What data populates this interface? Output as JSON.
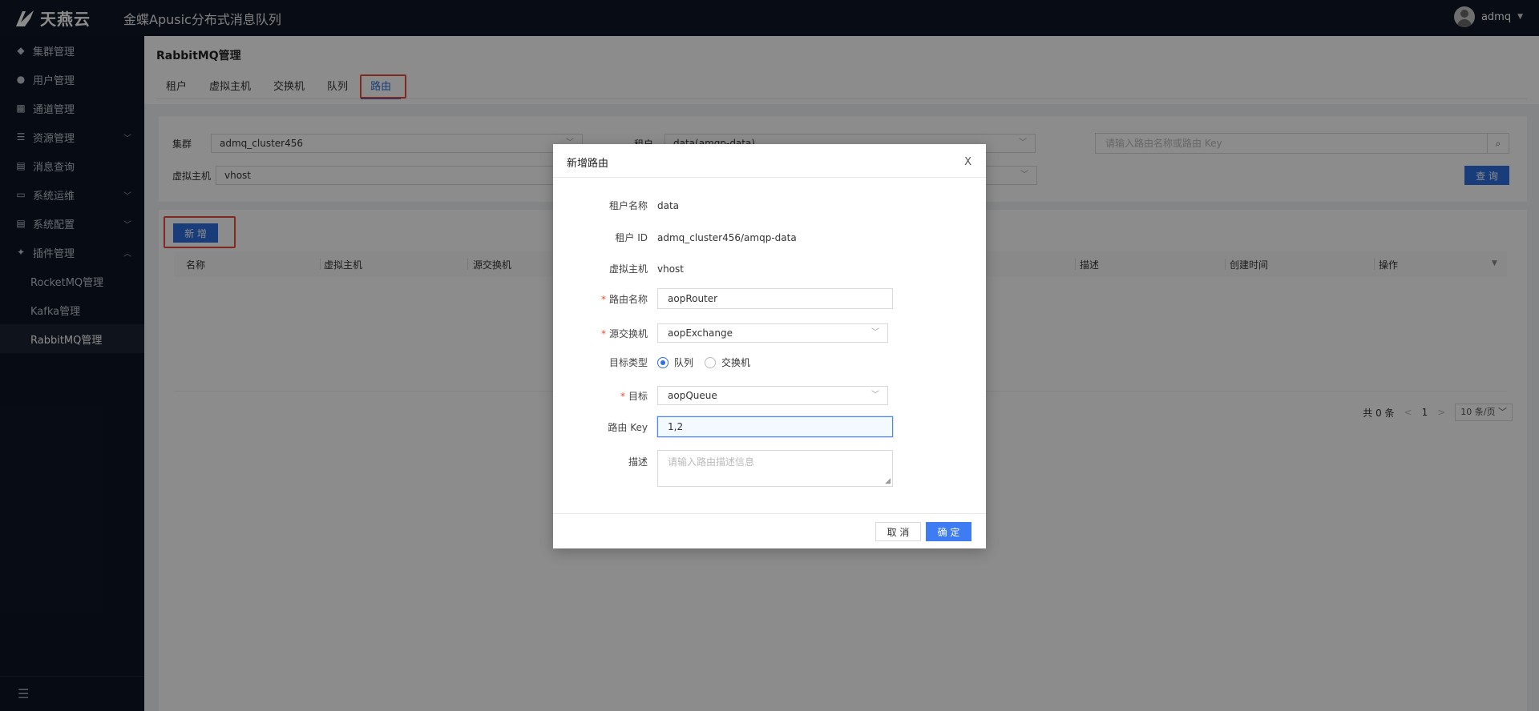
{
  "header": {
    "logo_text": "天燕云",
    "app_title": "金蝶Apusic分布式消息队列",
    "user_name": "admq",
    "caret": "▼"
  },
  "sidebar": {
    "items": [
      {
        "label": "集群管理",
        "icon": "cube-icon",
        "glyph": "◆"
      },
      {
        "label": "用户管理",
        "icon": "user-icon",
        "glyph": "●"
      },
      {
        "label": "通道管理",
        "icon": "channel-icon",
        "glyph": "▦"
      },
      {
        "label": "资源管理",
        "icon": "resource-icon",
        "glyph": "☰",
        "chevron": "﹀"
      },
      {
        "label": "消息查询",
        "icon": "document-icon",
        "glyph": "▤"
      },
      {
        "label": "系统运维",
        "icon": "terminal-icon",
        "glyph": "▭",
        "chevron": "﹀"
      },
      {
        "label": "系统配置",
        "icon": "settings-icon",
        "glyph": "▤",
        "chevron": "﹀"
      },
      {
        "label": "插件管理",
        "icon": "plugin-icon",
        "glyph": "✦",
        "chevron": "︿"
      }
    ],
    "sub_items": [
      "RocketMQ管理",
      "Kafka管理",
      "RabbitMQ管理"
    ],
    "collapse_glyph": "☰"
  },
  "page": {
    "title": "RabbitMQ管理",
    "tabs": [
      "租户",
      "虚拟主机",
      "交换机",
      "队列",
      "路由"
    ]
  },
  "filters": {
    "cluster_label": "集群",
    "cluster_value": "admq_cluster456",
    "tenant_label": "租户",
    "tenant_value": "data(amqp-data)",
    "vhost_label": "虚拟主机",
    "vhost_value": "vhost",
    "search_placeholder": "请输入路由名称或路由 Key",
    "query_button": "查 询",
    "dropdown_glyph": "﹀",
    "search_glyph": "⌕"
  },
  "table": {
    "add_button": "新 增",
    "columns": [
      "名称",
      "虚拟主机",
      "源交换机",
      "描述",
      "创建时间",
      "操作"
    ],
    "filter_glyph": "▼"
  },
  "pagination": {
    "total": "共 0 条",
    "prev": "<",
    "page": "1",
    "next": ">",
    "page_size": "10 条/页 ﹀"
  },
  "modal": {
    "title": "新增路由",
    "close": "X",
    "tenant_name_label": "租户名称",
    "tenant_name_value": "data",
    "tenant_id_label": "租户 ID",
    "tenant_id_value": "admq_cluster456/amqp-data",
    "vhost_label": "虚拟主机",
    "vhost_value": "vhost",
    "route_name_label": "路由名称",
    "route_name_value": "aopRouter",
    "source_exchange_label": "源交换机",
    "source_exchange_value": "aopExchange",
    "target_type_label": "目标类型",
    "target_type_options": [
      "队列",
      "交换机"
    ],
    "target_type_selected": "队列",
    "target_label": "目标",
    "target_value": "aopQueue",
    "route_key_label": "路由 Key",
    "route_key_value": "1,2",
    "desc_label": "描述",
    "desc_placeholder": "请输入路由描述信息",
    "required_mark": "*",
    "cancel_button": "取 消",
    "ok_button": "确 定"
  }
}
